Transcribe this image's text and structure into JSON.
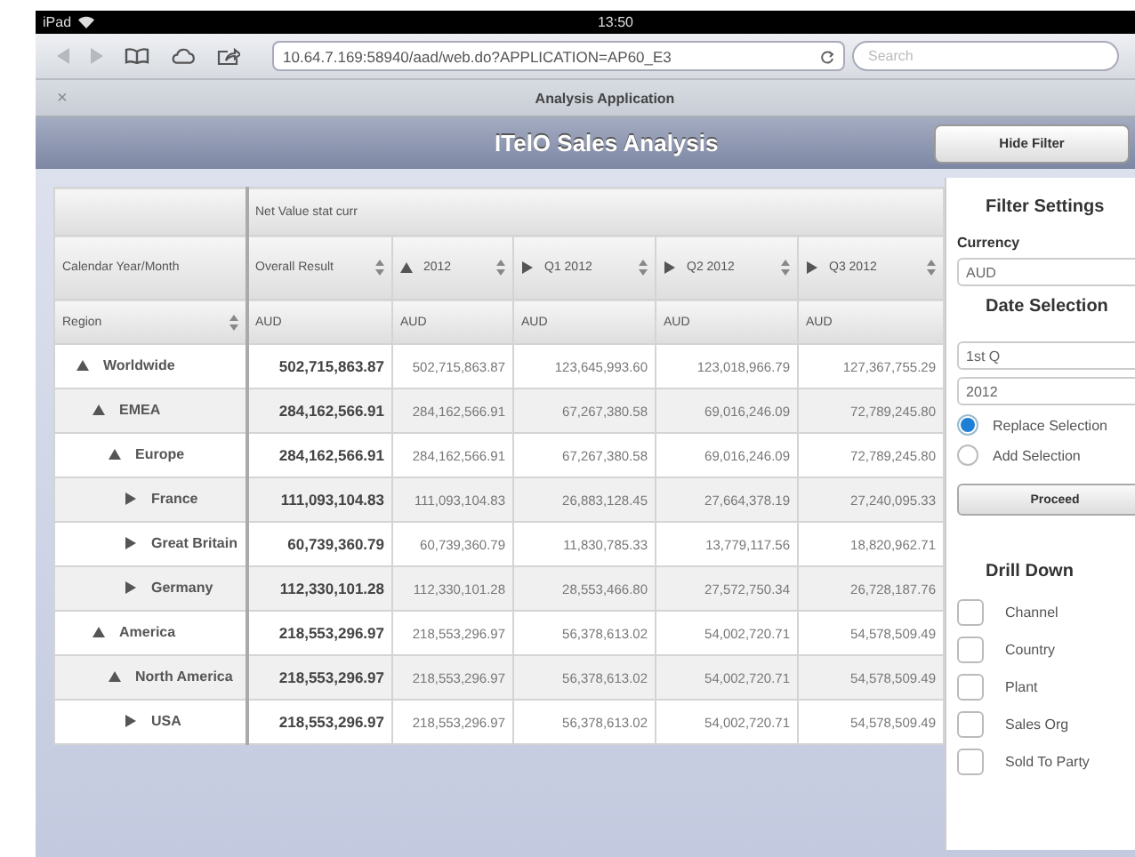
{
  "status_bar": {
    "carrier": "iPad",
    "time": "13:50"
  },
  "browser": {
    "url": "10.64.7.169:58940/aad/web.do?APPLICATION=AP60_E3",
    "search": {
      "placeholder": "Search"
    }
  },
  "tab": {
    "close": "×",
    "title": "Analysis Application"
  },
  "header": {
    "title": "ITelO Sales Analysis",
    "button": "Hide Filter"
  },
  "table": {
    "measure": "Net Value stat curr",
    "column_dimension": "Calendar Year/Month",
    "row_dimension": "Region",
    "total_column": {
      "label": "Overall Result",
      "unit": "AUD"
    },
    "period_columns": [
      {
        "label": "2012",
        "expanded": true,
        "unit": "AUD"
      },
      {
        "label": "Q1 2012",
        "expanded": false,
        "unit": "AUD"
      },
      {
        "label": "Q2 2012",
        "expanded": false,
        "unit": "AUD"
      },
      {
        "label": "Q3 2012",
        "expanded": false,
        "unit": "AUD"
      }
    ],
    "rows": [
      {
        "label": "Worldwide",
        "expanded": true,
        "total": "502,715,863.87",
        "values": [
          "502,715,863.87",
          "123,645,993.60",
          "123,018,966.79",
          "127,367,755.29"
        ],
        "children": [
          {
            "label": "EMEA",
            "expanded": true,
            "total": "284,162,566.91",
            "values": [
              "284,162,566.91",
              "67,267,380.58",
              "69,016,246.09",
              "72,789,245.80"
            ],
            "children": [
              {
                "label": "Europe",
                "expanded": true,
                "total": "284,162,566.91",
                "values": [
                  "284,162,566.91",
                  "67,267,380.58",
                  "69,016,246.09",
                  "72,789,245.80"
                ],
                "children": [
                  {
                    "label": "France",
                    "expanded": false,
                    "total": "111,093,104.83",
                    "values": [
                      "111,093,104.83",
                      "26,883,128.45",
                      "27,664,378.19",
                      "27,240,095.33"
                    ]
                  },
                  {
                    "label": "Great Britain",
                    "expanded": false,
                    "total": "60,739,360.79",
                    "values": [
                      "60,739,360.79",
                      "11,830,785.33",
                      "13,779,117.56",
                      "18,820,962.71"
                    ]
                  },
                  {
                    "label": "Germany",
                    "expanded": false,
                    "total": "112,330,101.28",
                    "values": [
                      "112,330,101.28",
                      "28,553,466.80",
                      "27,572,750.34",
                      "26,728,187.76"
                    ]
                  }
                ]
              }
            ]
          },
          {
            "label": "America",
            "expanded": true,
            "total": "218,553,296.97",
            "values": [
              "218,553,296.97",
              "56,378,613.02",
              "54,002,720.71",
              "54,578,509.49"
            ],
            "children": [
              {
                "label": "North America",
                "expanded": true,
                "total": "218,553,296.97",
                "values": [
                  "218,553,296.97",
                  "56,378,613.02",
                  "54,002,720.71",
                  "54,578,509.49"
                ],
                "children": [
                  {
                    "label": "USA",
                    "expanded": false,
                    "total": "218,553,296.97",
                    "values": [
                      "218,553,296.97",
                      "56,378,613.02",
                      "54,002,720.71",
                      "54,578,509.49"
                    ]
                  }
                ]
              }
            ]
          }
        ]
      }
    ]
  },
  "filter": {
    "title": "Filter Settings",
    "currency_label": "Currency",
    "currency": "AUD",
    "date_title": "Date Selection",
    "quarter": "1st Q",
    "year": "2012",
    "modes": [
      {
        "label": "Replace Selection",
        "selected": true
      },
      {
        "label": "Add Selection",
        "selected": false
      }
    ],
    "proceed": "Proceed",
    "drill_title": "Drill Down",
    "drill": [
      {
        "label": "Channel",
        "checked": false
      },
      {
        "label": "Country",
        "checked": false
      },
      {
        "label": "Plant",
        "checked": false
      },
      {
        "label": "Sales Org",
        "checked": false
      },
      {
        "label": "Sold To Party",
        "checked": false
      }
    ]
  }
}
